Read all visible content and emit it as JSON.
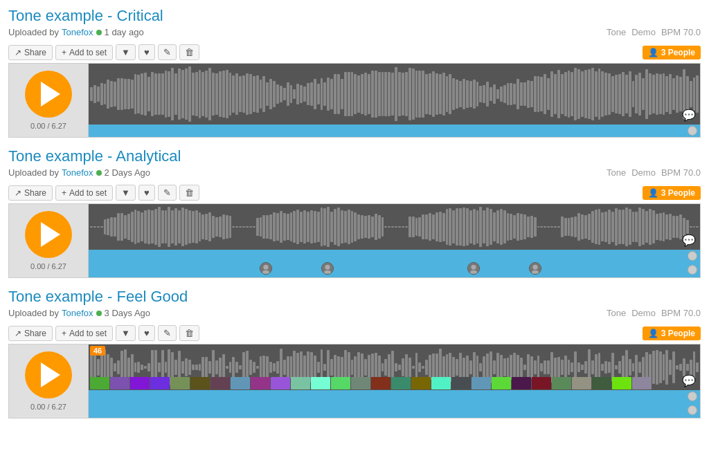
{
  "tracks": [
    {
      "id": "track-1",
      "title": "Tone example - Critical",
      "uploader": "Tonefox",
      "uploaded_ago": "1 day ago",
      "tone_label": "Tone",
      "demo_label": "Demo",
      "bpm_label": "BPM",
      "bpm_value": "70.0",
      "time": "0.00 / 6.27",
      "people_count": "3 People",
      "buttons": {
        "share": "Share",
        "add_to_set": "Add to set",
        "download": "↓",
        "like": "♥",
        "edit": "✎",
        "delete": "🗑"
      },
      "waveform_type": "smooth",
      "has_markers": false
    },
    {
      "id": "track-2",
      "title": "Tone example - Analytical",
      "uploader": "Tonefox",
      "uploaded_ago": "2 Days Ago",
      "tone_label": "Tone",
      "demo_label": "Demo",
      "bpm_label": "BPM",
      "bpm_value": "70.0",
      "time": "0.00 / 6.27",
      "people_count": "3 People",
      "buttons": {
        "share": "Share",
        "add_to_set": "Add to set",
        "download": "↓",
        "like": "♥",
        "edit": "✎",
        "delete": "🗑"
      },
      "waveform_type": "segmented",
      "has_markers": true,
      "markers": [
        {
          "left": "28%"
        },
        {
          "left": "38%"
        },
        {
          "left": "62%"
        },
        {
          "left": "72%"
        }
      ]
    },
    {
      "id": "track-3",
      "title": "Tone example -  Feel Good",
      "uploader": "Tonefox",
      "uploaded_ago": "3 Days Ago",
      "tone_label": "Tone",
      "demo_label": "Demo",
      "bpm_label": "BPM",
      "bpm_value": "70.0",
      "time": "0.00 / 6.27",
      "people_count": "3 People",
      "buttons": {
        "share": "Share",
        "add_to_set": "Add to set",
        "download": "↓",
        "like": "♥",
        "edit": "✎",
        "delete": "🗑"
      },
      "waveform_type": "dense",
      "has_markers": true,
      "number_badge": "46",
      "markers": []
    }
  ]
}
